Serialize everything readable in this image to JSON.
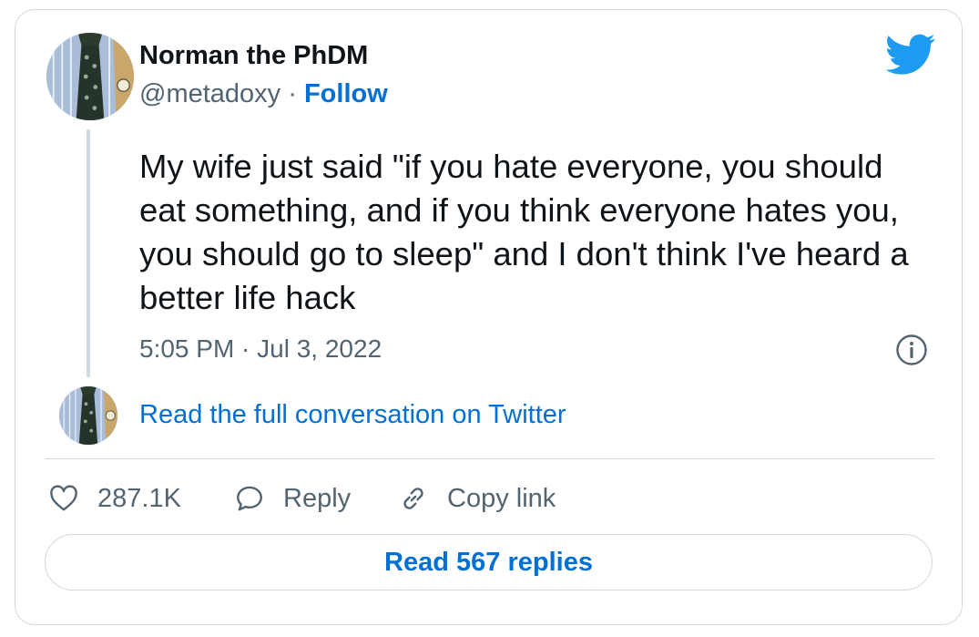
{
  "author": {
    "name": "Norman the PhDM",
    "handle": "@metadoxy",
    "separator": "·",
    "follow_label": "Follow"
  },
  "tweet": {
    "text": "My wife just said \"if you hate everyone, you should eat something, and if you think everyone hates you, you should go to sleep\" and I don't think I've heard a better life hack",
    "timestamp": "5:05 PM · Jul 3, 2022"
  },
  "conversation_link": "Read the full conversation on Twitter",
  "actions": {
    "like_count": "287.1K",
    "reply_label": "Reply",
    "copy_link_label": "Copy link"
  },
  "read_replies_label": "Read 567 replies",
  "icons": {
    "brand": "twitter-bird-icon",
    "info": "info-icon",
    "like": "heart-icon",
    "reply": "speech-bubble-icon",
    "copy": "link-icon"
  },
  "colors": {
    "accent": "#006fd6",
    "twitter_blue": "#1d9bf0",
    "secondary_text": "#536471",
    "border": "#cfd9de"
  }
}
